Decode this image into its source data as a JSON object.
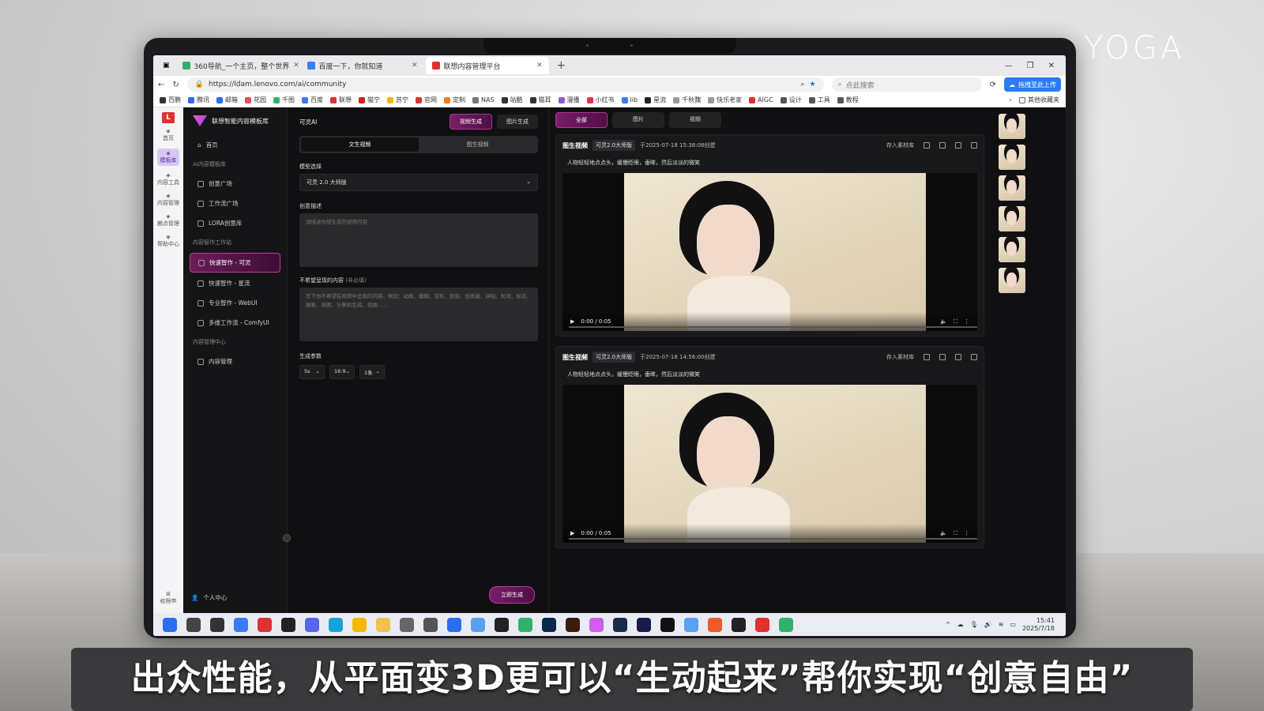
{
  "overlay": {
    "brand": "YOGA",
    "subtitle": "出众性能，从平面变3D更可以“生动起来”帮你实现“创意自由”"
  },
  "browser": {
    "tabs": [
      {
        "label": "360导航_一个主页，整个世界",
        "color": "#2fb36b",
        "active": false
      },
      {
        "label": "百度一下，你就知道",
        "color": "#3b7bf7",
        "active": false
      },
      {
        "label": "联想内容管理平台",
        "color": "#e03030",
        "active": true
      }
    ],
    "url": "https://ldam.lenovo.com/ai/community",
    "search_placeholder": "点此搜索",
    "cloud_button": "拖拽至此上传",
    "bookmarks": [
      {
        "label": "百鹏",
        "color": "#333"
      },
      {
        "label": "腾讯",
        "color": "#2b6cf0"
      },
      {
        "label": "邮箱",
        "color": "#2b6cf0"
      },
      {
        "label": "花园",
        "color": "#e84a5f"
      },
      {
        "label": "千图",
        "color": "#2fb36b"
      },
      {
        "label": "百度",
        "color": "#3b7bf7"
      },
      {
        "label": "联想",
        "color": "#e03030"
      },
      {
        "label": "猫宁",
        "color": "#d02020"
      },
      {
        "label": "苏宁",
        "color": "#f5b800"
      },
      {
        "label": "官网",
        "color": "#e03030"
      },
      {
        "label": "定制",
        "color": "#f07b1d"
      },
      {
        "label": "NAS",
        "color": "#777"
      },
      {
        "label": "站酷",
        "color": "#333"
      },
      {
        "label": "猫耳",
        "color": "#333"
      },
      {
        "label": "漫播",
        "color": "#8c5bd6"
      },
      {
        "label": "小红书",
        "color": "#e8304a"
      },
      {
        "label": "lib",
        "color": "#3b7bf7"
      },
      {
        "label": "星流",
        "color": "#222"
      },
      {
        "label": "千秋魏",
        "color": "#999"
      },
      {
        "label": "快乐老家",
        "color": "#999"
      },
      {
        "label": "AIGC",
        "color": "#e03030"
      },
      {
        "label": "设计",
        "color": "#555"
      },
      {
        "label": "工具",
        "color": "#555"
      },
      {
        "label": "教程",
        "color": "#555"
      }
    ],
    "other_bookmarks": "其他收藏夹"
  },
  "app": {
    "rail": [
      {
        "label": "首页",
        "active": false
      },
      {
        "label": "模板库",
        "active": true
      },
      {
        "label": "内容工具",
        "active": false
      },
      {
        "label": "内容管理",
        "active": false
      },
      {
        "label": "触点管理",
        "active": false
      },
      {
        "label": "帮助中心",
        "active": false
      }
    ],
    "rail_bottom": "权限申",
    "sidebar": {
      "title": "联想智能内容模板库",
      "home": "首页",
      "section1": "AI内容模板库",
      "items1": [
        "创意广场",
        "工作流广场",
        "LORA创意库"
      ],
      "section2": "内容智作工作站",
      "items2": [
        "快速智作 - 可灵",
        "快速智作 - 星流",
        "专业智作 - WebUI",
        "多维工作流 - ComfyUI"
      ],
      "section3": "内容管理中心",
      "items3": [
        "内容管理"
      ],
      "user": "个人中心"
    },
    "form": {
      "title": "可灵AI",
      "mode_tabs": [
        "视频生成",
        "图片生成"
      ],
      "sub_tabs": [
        "文生视频",
        "图生视频"
      ],
      "model_label": "模型选择",
      "model_value": "可灵 2.0 大师版",
      "desc_label": "创意描述",
      "desc_placeholder": "请描述你想生成的视频内容",
      "negative_label": "不希望呈现的内容",
      "negative_hint": "(非必填)",
      "negative_placeholder": "写下你不希望在视频中呈现的内容。例如：动画、模糊、变形、毁容、低质量、拼贴、粒状、标志、抽象、插图、计算机生成、扭曲......",
      "params_label": "生成参数",
      "params": [
        "5s",
        "16:9",
        "1条"
      ],
      "generate": "立即生成"
    },
    "results": {
      "filters": [
        "全部",
        "图片",
        "视频"
      ],
      "cards": [
        {
          "type": "图生视频",
          "tag": "可灵2.0大师版",
          "time": "于2025-07-18 15:38:08创建",
          "save": "存入素材库",
          "prompt": "人物轻轻地点点头，缓慢眨眼，垂眸，然后淡淡的微笑",
          "timecode": "0:00 / 0:05"
        },
        {
          "type": "图生视频",
          "tag": "可灵2.0大师版",
          "time": "于2025-07-18 14:56:00创建",
          "save": "存入素材库",
          "prompt": "人物轻轻地点点头，缓慢眨眼，垂眸，然后淡淡的微笑",
          "timecode": "0:00 / 0:05"
        }
      ]
    }
  },
  "taskbar": {
    "icons": [
      {
        "name": "start-icon",
        "color": "#2b6cf0"
      },
      {
        "name": "search-icon",
        "color": "#444"
      },
      {
        "name": "taskview-icon",
        "color": "#333"
      },
      {
        "name": "app-icon",
        "color": "#3b7bf7"
      },
      {
        "name": "youdao-icon",
        "color": "#e03030"
      },
      {
        "name": "app-icon",
        "color": "#222"
      },
      {
        "name": "discord-icon",
        "color": "#5865f2"
      },
      {
        "name": "edge-icon",
        "color": "#1aa0d8"
      },
      {
        "name": "chrome-icon",
        "color": "#f5b800"
      },
      {
        "name": "folder-icon",
        "color": "#f2c14e"
      },
      {
        "name": "settings-icon",
        "color": "#666"
      },
      {
        "name": "pen-icon",
        "color": "#555"
      },
      {
        "name": "app-icon",
        "color": "#2b6cf0"
      },
      {
        "name": "app-icon",
        "color": "#5aa0f0"
      },
      {
        "name": "qq-icon",
        "color": "#222"
      },
      {
        "name": "wechat-icon",
        "color": "#2fb36b"
      },
      {
        "name": "photoshop-icon",
        "color": "#0b2a4a"
      },
      {
        "name": "illustrator-icon",
        "color": "#3a1e0a"
      },
      {
        "name": "app-icon",
        "color": "#d05cf0"
      },
      {
        "name": "app-icon",
        "color": "#1b2b4b"
      },
      {
        "name": "audition-icon",
        "color": "#1a1a4a"
      },
      {
        "name": "capcut-icon",
        "color": "#111"
      },
      {
        "name": "app-icon",
        "color": "#5aa0f0"
      },
      {
        "name": "app-icon",
        "color": "#f05a28"
      },
      {
        "name": "app-icon",
        "color": "#222"
      },
      {
        "name": "wps-icon",
        "color": "#e03030"
      },
      {
        "name": "app-icon",
        "color": "#2fb36b"
      }
    ],
    "time": "15:41",
    "date": "2025/7/18"
  }
}
